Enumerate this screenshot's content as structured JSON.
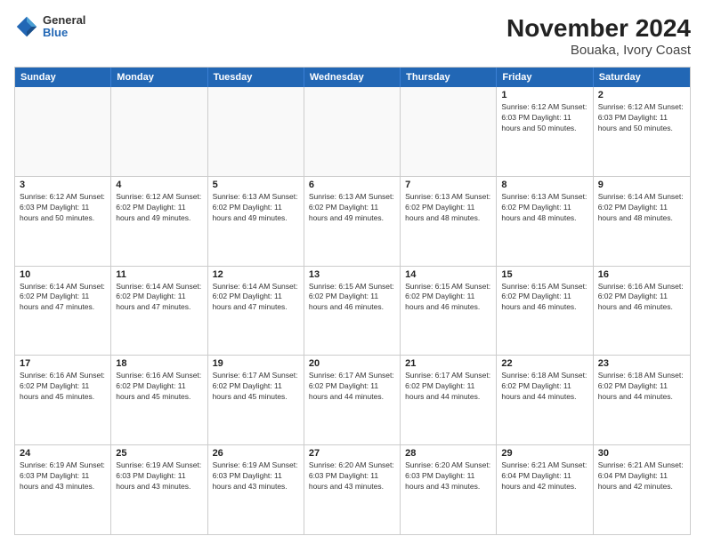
{
  "logo": {
    "line1": "General",
    "line2": "Blue"
  },
  "title": "November 2024",
  "subtitle": "Bouaka, Ivory Coast",
  "days_of_week": [
    "Sunday",
    "Monday",
    "Tuesday",
    "Wednesday",
    "Thursday",
    "Friday",
    "Saturday"
  ],
  "rows": [
    [
      {
        "day": "",
        "empty": true
      },
      {
        "day": "",
        "empty": true
      },
      {
        "day": "",
        "empty": true
      },
      {
        "day": "",
        "empty": true
      },
      {
        "day": "",
        "empty": true
      },
      {
        "day": "1",
        "info": "Sunrise: 6:12 AM\nSunset: 6:03 PM\nDaylight: 11 hours and 50 minutes."
      },
      {
        "day": "2",
        "info": "Sunrise: 6:12 AM\nSunset: 6:03 PM\nDaylight: 11 hours and 50 minutes."
      }
    ],
    [
      {
        "day": "3",
        "info": "Sunrise: 6:12 AM\nSunset: 6:03 PM\nDaylight: 11 hours and 50 minutes."
      },
      {
        "day": "4",
        "info": "Sunrise: 6:12 AM\nSunset: 6:02 PM\nDaylight: 11 hours and 49 minutes."
      },
      {
        "day": "5",
        "info": "Sunrise: 6:13 AM\nSunset: 6:02 PM\nDaylight: 11 hours and 49 minutes."
      },
      {
        "day": "6",
        "info": "Sunrise: 6:13 AM\nSunset: 6:02 PM\nDaylight: 11 hours and 49 minutes."
      },
      {
        "day": "7",
        "info": "Sunrise: 6:13 AM\nSunset: 6:02 PM\nDaylight: 11 hours and 48 minutes."
      },
      {
        "day": "8",
        "info": "Sunrise: 6:13 AM\nSunset: 6:02 PM\nDaylight: 11 hours and 48 minutes."
      },
      {
        "day": "9",
        "info": "Sunrise: 6:14 AM\nSunset: 6:02 PM\nDaylight: 11 hours and 48 minutes."
      }
    ],
    [
      {
        "day": "10",
        "info": "Sunrise: 6:14 AM\nSunset: 6:02 PM\nDaylight: 11 hours and 47 minutes."
      },
      {
        "day": "11",
        "info": "Sunrise: 6:14 AM\nSunset: 6:02 PM\nDaylight: 11 hours and 47 minutes."
      },
      {
        "day": "12",
        "info": "Sunrise: 6:14 AM\nSunset: 6:02 PM\nDaylight: 11 hours and 47 minutes."
      },
      {
        "day": "13",
        "info": "Sunrise: 6:15 AM\nSunset: 6:02 PM\nDaylight: 11 hours and 46 minutes."
      },
      {
        "day": "14",
        "info": "Sunrise: 6:15 AM\nSunset: 6:02 PM\nDaylight: 11 hours and 46 minutes."
      },
      {
        "day": "15",
        "info": "Sunrise: 6:15 AM\nSunset: 6:02 PM\nDaylight: 11 hours and 46 minutes."
      },
      {
        "day": "16",
        "info": "Sunrise: 6:16 AM\nSunset: 6:02 PM\nDaylight: 11 hours and 46 minutes."
      }
    ],
    [
      {
        "day": "17",
        "info": "Sunrise: 6:16 AM\nSunset: 6:02 PM\nDaylight: 11 hours and 45 minutes."
      },
      {
        "day": "18",
        "info": "Sunrise: 6:16 AM\nSunset: 6:02 PM\nDaylight: 11 hours and 45 minutes."
      },
      {
        "day": "19",
        "info": "Sunrise: 6:17 AM\nSunset: 6:02 PM\nDaylight: 11 hours and 45 minutes."
      },
      {
        "day": "20",
        "info": "Sunrise: 6:17 AM\nSunset: 6:02 PM\nDaylight: 11 hours and 44 minutes."
      },
      {
        "day": "21",
        "info": "Sunrise: 6:17 AM\nSunset: 6:02 PM\nDaylight: 11 hours and 44 minutes."
      },
      {
        "day": "22",
        "info": "Sunrise: 6:18 AM\nSunset: 6:02 PM\nDaylight: 11 hours and 44 minutes."
      },
      {
        "day": "23",
        "info": "Sunrise: 6:18 AM\nSunset: 6:02 PM\nDaylight: 11 hours and 44 minutes."
      }
    ],
    [
      {
        "day": "24",
        "info": "Sunrise: 6:19 AM\nSunset: 6:03 PM\nDaylight: 11 hours and 43 minutes."
      },
      {
        "day": "25",
        "info": "Sunrise: 6:19 AM\nSunset: 6:03 PM\nDaylight: 11 hours and 43 minutes."
      },
      {
        "day": "26",
        "info": "Sunrise: 6:19 AM\nSunset: 6:03 PM\nDaylight: 11 hours and 43 minutes."
      },
      {
        "day": "27",
        "info": "Sunrise: 6:20 AM\nSunset: 6:03 PM\nDaylight: 11 hours and 43 minutes."
      },
      {
        "day": "28",
        "info": "Sunrise: 6:20 AM\nSunset: 6:03 PM\nDaylight: 11 hours and 43 minutes."
      },
      {
        "day": "29",
        "info": "Sunrise: 6:21 AM\nSunset: 6:04 PM\nDaylight: 11 hours and 42 minutes."
      },
      {
        "day": "30",
        "info": "Sunrise: 6:21 AM\nSunset: 6:04 PM\nDaylight: 11 hours and 42 minutes."
      }
    ]
  ]
}
